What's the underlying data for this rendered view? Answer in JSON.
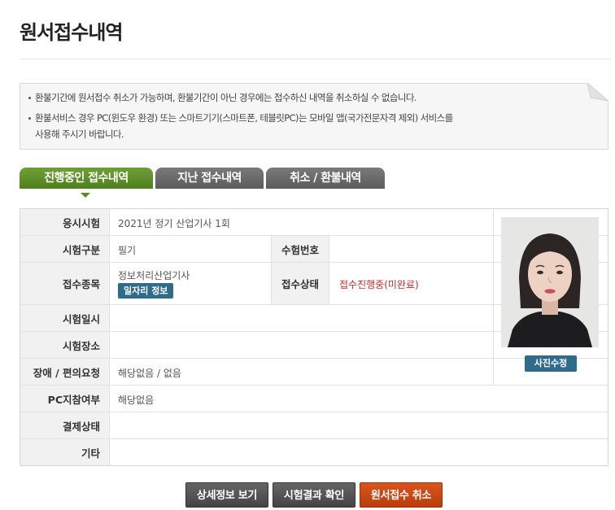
{
  "page": {
    "title": "원서접수내역"
  },
  "notice": {
    "line1": "환불기간에 원서접수 취소가 가능하며, 환불기간이 아닌 경우에는 접수하신 내역을 취소하실 수 없습니다.",
    "line2": "환불서비스 경우 PC(윈도우 환경) 또는 스마트기기(스마트폰, 테블릿PC)는 모바일 앱(국가전문자격 제외) 서비스를",
    "line3": "사용해 주시기 바랍니다."
  },
  "tabs": [
    {
      "label": "진행중인 접수내역",
      "active": true
    },
    {
      "label": "지난 접수내역",
      "active": false
    },
    {
      "label": "취소 / 환불내역",
      "active": false
    }
  ],
  "details": {
    "exam_label": "응시시험",
    "exam_value": "2021년 정기 산업기사 1회",
    "category_label": "시험구분",
    "category_value": "필기",
    "exam_no_label": "수험번호",
    "exam_no_value": "",
    "item_label": "접수종목",
    "item_value": "정보처리산업기사",
    "job_info_button": "일자리 정보",
    "status_label": "접수상태",
    "status_value": "접수진행중(미완료)",
    "date_label": "시험일시",
    "date_value": "",
    "place_label": "시험장소",
    "place_value": "",
    "accommodation_label": "장애 / 편의요청",
    "accommodation_value": "해당없음 / 없음",
    "pc_label": "PC지참여부",
    "pc_value": "해당없음",
    "payment_label": "결제상태",
    "payment_value": "",
    "etc_label": "기타",
    "etc_value": ""
  },
  "photo": {
    "edit_button": "사진수정"
  },
  "actions": {
    "detail_button": "상세정보 보기",
    "result_button": "시험결과 확인",
    "cancel_button": "원서접수 취소"
  },
  "colors": {
    "active_tab": "#5a8c25",
    "inactive_tab": "#6b6b6b",
    "info_button": "#2f6b8a",
    "cancel_button": "#c4470f",
    "status_text": "#c0302c"
  }
}
